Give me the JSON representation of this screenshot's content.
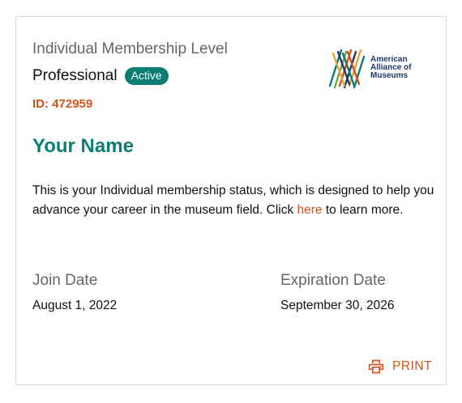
{
  "membership": {
    "level_label": "Individual Membership Level",
    "level_name": "Professional",
    "status_badge": "Active",
    "member_id": "ID: 472959",
    "member_name": "Your Name"
  },
  "logo": {
    "line1": "American",
    "line2": "Alliance of",
    "line3": "Museums",
    "colors": [
      "#0b7d74",
      "#d4531c",
      "#1d3a6b",
      "#e8a33a",
      "#6aa84f"
    ]
  },
  "description": {
    "text_before": "This is your Individual membership status, which is designed to help you advance your career in the museum field. Click ",
    "link_text": "here",
    "text_after": " to learn more."
  },
  "dates": {
    "join_label": "Join Date",
    "join_value": "August 1, 2022",
    "expiration_label": "Expiration Date",
    "expiration_value": "September 30, 2026"
  },
  "actions": {
    "print_label": "PRINT",
    "print_icon": "printer-icon"
  },
  "colors": {
    "accent_teal": "#0b7d74",
    "accent_orange": "#d4531c",
    "muted_text": "#666666"
  }
}
